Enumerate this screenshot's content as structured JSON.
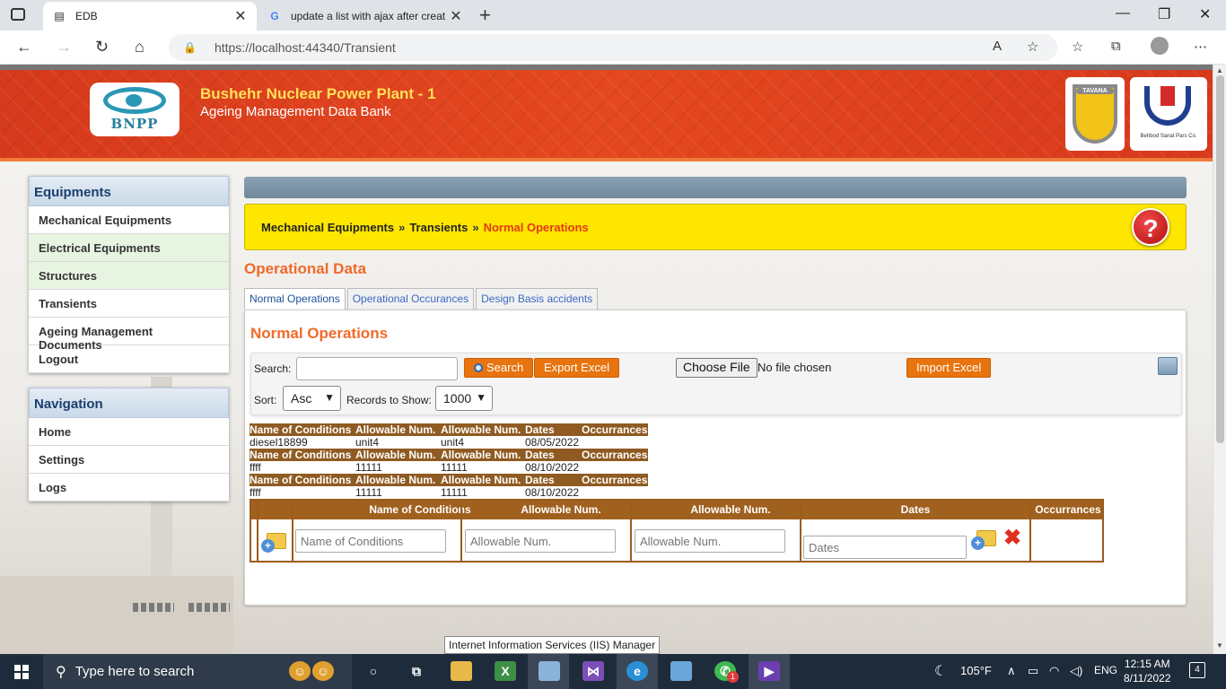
{
  "browser": {
    "tabs": [
      {
        "title": "EDB",
        "active": true
      },
      {
        "title": "update a list with ajax after creat",
        "active": false
      }
    ],
    "url": "https://localhost:44340/Transient"
  },
  "header": {
    "logo_text": "BNPP",
    "title": "Bushehr Nuclear Power Plant - 1",
    "subtitle": "Ageing Management Data Bank",
    "logo_tavana": "TAVANA",
    "logo_behbod": "Behbod Sanat Pars Co."
  },
  "sidebar": {
    "equipments_title": "Equipments",
    "equipments": [
      {
        "label": "Mechanical Equipments"
      },
      {
        "label": "Electrical Equipments"
      },
      {
        "label": "Structures"
      },
      {
        "label": "Transients"
      },
      {
        "label": "Ageing Management Documents"
      },
      {
        "label": "Logout"
      }
    ],
    "navigation_title": "Navigation",
    "navigation": [
      {
        "label": "Home"
      },
      {
        "label": "Settings"
      },
      {
        "label": "Logs"
      }
    ]
  },
  "breadcrumb": {
    "items": [
      "Mechanical Equipments",
      "Transients"
    ],
    "separator": "»",
    "current": "Normal Operations"
  },
  "section_title": "Operational Data",
  "tabs": [
    {
      "label": "Normal Operations",
      "active": true
    },
    {
      "label": "Operational Occurances",
      "active": false
    },
    {
      "label": "Design Basis accidents",
      "active": false
    }
  ],
  "panel": {
    "title": "Normal Operations",
    "search_label": "Search:",
    "search_value": "",
    "search_button": "Search",
    "export_button": "Export Excel",
    "choose_file_button": "Choose File",
    "no_file": "No file chosen",
    "import_button": "Import Excel",
    "sort_label": "Sort:",
    "sort_value": "Asc",
    "records_label": "Records to Show:",
    "records_value": "1000"
  },
  "records": {
    "headers": [
      "Name of Conditions",
      "Allowable Num.",
      "Allowable Num.",
      "Dates",
      "Occurrances"
    ],
    "rows": [
      [
        "diesel18899",
        "unit4",
        "unit4",
        "08/05/2022",
        ""
      ],
      [
        "ffff",
        "11111",
        "11111",
        "08/10/2022",
        ""
      ],
      [
        "ffff",
        "11111",
        "11111",
        "08/10/2022",
        ""
      ]
    ]
  },
  "grid": {
    "headers": [
      "Name of Conditions",
      "Allowable Num.",
      "Allowable Num.",
      "Dates",
      "Occurrances"
    ],
    "placeholders": [
      "Name of Conditions",
      "Allowable Num.",
      "Allowable Num.",
      "Dates"
    ]
  },
  "tooltip": "Internet Information Services (IIS) Manager",
  "taskbar": {
    "search_placeholder": "Type here to search",
    "weather": "105°F",
    "language": "ENG",
    "time": "12:15 AM",
    "date": "8/11/2022",
    "notifications": "4",
    "whatsapp_badge": "1"
  }
}
